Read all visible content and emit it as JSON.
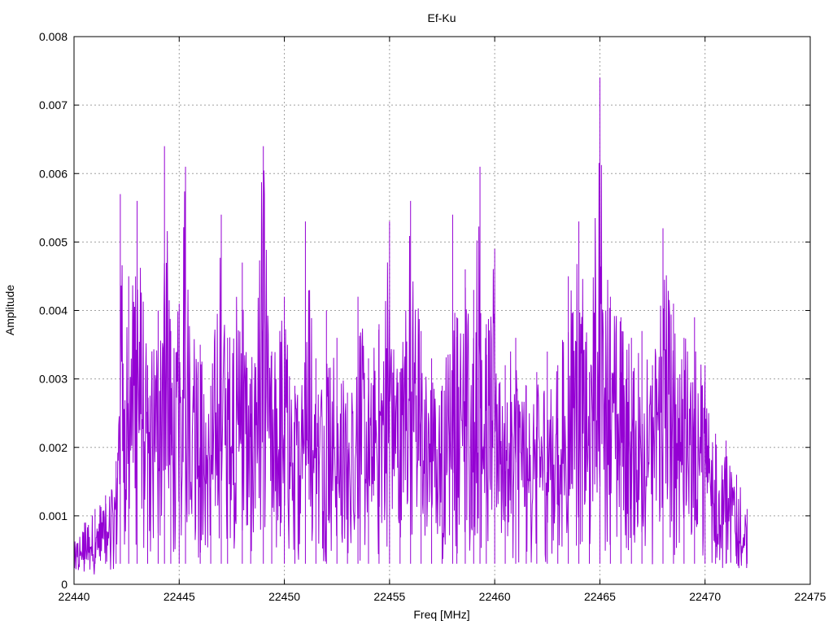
{
  "chart_data": {
    "type": "line",
    "title": "Ef-Ku",
    "xlabel": "Freq [MHz]",
    "ylabel": "Amplitude",
    "xlim": [
      22440,
      22475
    ],
    "ylim": [
      0,
      0.008
    ],
    "xticks": [
      22440,
      22445,
      22450,
      22455,
      22460,
      22465,
      22470,
      22475
    ],
    "yticks": [
      0,
      0.001,
      0.002,
      0.003,
      0.004,
      0.005,
      0.006,
      0.007,
      0.008
    ],
    "ytick_labels": [
      "0",
      "0.001",
      "0.002",
      "0.003",
      "0.004",
      "0.005",
      "0.006",
      "0.007",
      "0.008"
    ],
    "grid": true,
    "color": "#9400d3",
    "series": [
      {
        "x": [
          22440.0,
          22440.5,
          22441.0,
          22441.5,
          22442.0,
          22442.2,
          22442.6,
          22443.0,
          22443.5,
          22444.0,
          22444.3,
          22444.6,
          22445.0,
          22445.3,
          22446.0,
          22446.5,
          22447.0,
          22447.3,
          22448.0,
          22448.4,
          22449.0,
          22449.4,
          22450.0,
          22450.5,
          22451.0,
          22451.5,
          22452.0,
          22452.5,
          22453.0,
          22453.5,
          22454.0,
          22454.5,
          22455.0,
          22455.5,
          22456.0,
          22456.5,
          22457.0,
          22457.5,
          22458.0,
          22458.2,
          22458.6,
          22459.0,
          22459.3,
          22459.6,
          22460.0,
          22460.5,
          22461.0,
          22461.5,
          22462.0,
          22462.5,
          22463.0,
          22463.5,
          22464.0,
          22464.5,
          22465.0,
          22465.5,
          22466.0,
          22466.5,
          22467.0,
          22467.5,
          22468.0,
          22468.5,
          22469.0,
          22469.5,
          22470.0,
          22470.5,
          22471.0,
          22471.5,
          22472.0
        ],
        "y": [
          0.0006,
          0.0009,
          0.0011,
          0.0013,
          0.0018,
          0.0057,
          0.0045,
          0.0056,
          0.0032,
          0.004,
          0.0064,
          0.0037,
          0.0041,
          0.0061,
          0.0035,
          0.0029,
          0.0054,
          0.0036,
          0.0047,
          0.003,
          0.0064,
          0.0034,
          0.0042,
          0.0029,
          0.0053,
          0.0033,
          0.004,
          0.0036,
          0.0028,
          0.0042,
          0.0033,
          0.0038,
          0.0053,
          0.0031,
          0.0056,
          0.0037,
          0.0033,
          0.0029,
          0.0054,
          0.0039,
          0.0046,
          0.0043,
          0.0061,
          0.0038,
          0.0049,
          0.0032,
          0.0036,
          0.0029,
          0.0031,
          0.0034,
          0.0032,
          0.0045,
          0.0053,
          0.0031,
          0.0074,
          0.0042,
          0.0039,
          0.0036,
          0.0037,
          0.0032,
          0.0052,
          0.0041,
          0.0036,
          0.0039,
          0.0032,
          0.0022,
          0.0021,
          0.0016,
          0.0011
        ]
      }
    ]
  }
}
